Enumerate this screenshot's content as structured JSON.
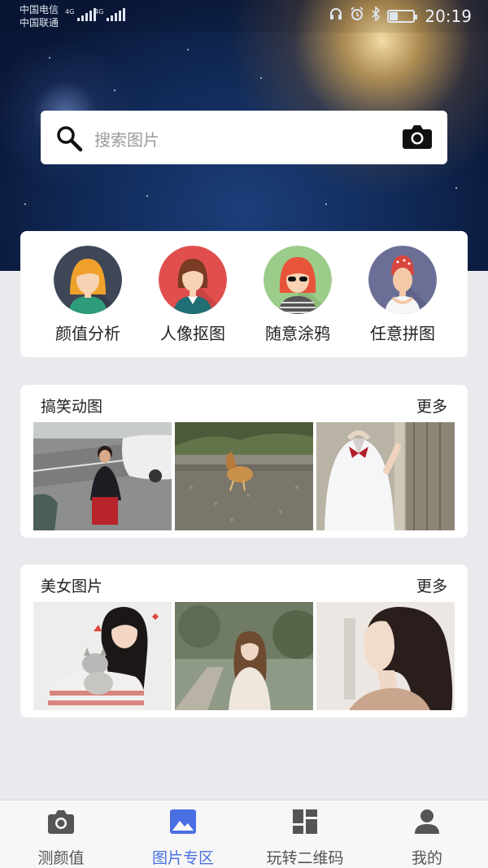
{
  "status_bar": {
    "carrier1": "中国电信",
    "carrier2": "中国联通",
    "network1": "4G",
    "network2": "4G",
    "time": "20:19",
    "icons": [
      "headphones-icon",
      "alarm-icon",
      "bluetooth-icon",
      "battery-icon"
    ]
  },
  "search": {
    "placeholder": "搜索图片",
    "left_icon": "search-icon",
    "right_icon": "camera-icon"
  },
  "features": [
    {
      "label": "颜值分析",
      "icon": "blonde-girl-avatar"
    },
    {
      "label": "人像抠图",
      "icon": "office-girl-avatar"
    },
    {
      "label": "随意涂鸦",
      "icon": "sunglasses-girl-avatar"
    },
    {
      "label": "任意拼图",
      "icon": "redhair-girl-avatar"
    }
  ],
  "sections": [
    {
      "title": "搞笑动图",
      "more": "更多",
      "thumbs": [
        "woman-on-street-photo",
        "chicken-photo",
        "girl-in-uniform-photo"
      ]
    },
    {
      "title": "美女图片",
      "more": "更多",
      "thumbs": [
        "girl-with-kitten-photo",
        "girl-in-garden-photo",
        "girl-portrait-photo"
      ]
    }
  ],
  "nav": {
    "items": [
      {
        "label": "测颜值",
        "icon": "camera-icon",
        "active": false
      },
      {
        "label": "图片专区",
        "icon": "image-icon",
        "active": true
      },
      {
        "label": "玩转二维码",
        "icon": "grid-icon",
        "active": false
      },
      {
        "label": "我的",
        "icon": "user-icon",
        "active": false
      }
    ],
    "active_color": "#4a6fe3",
    "inactive_color": "#555555"
  }
}
